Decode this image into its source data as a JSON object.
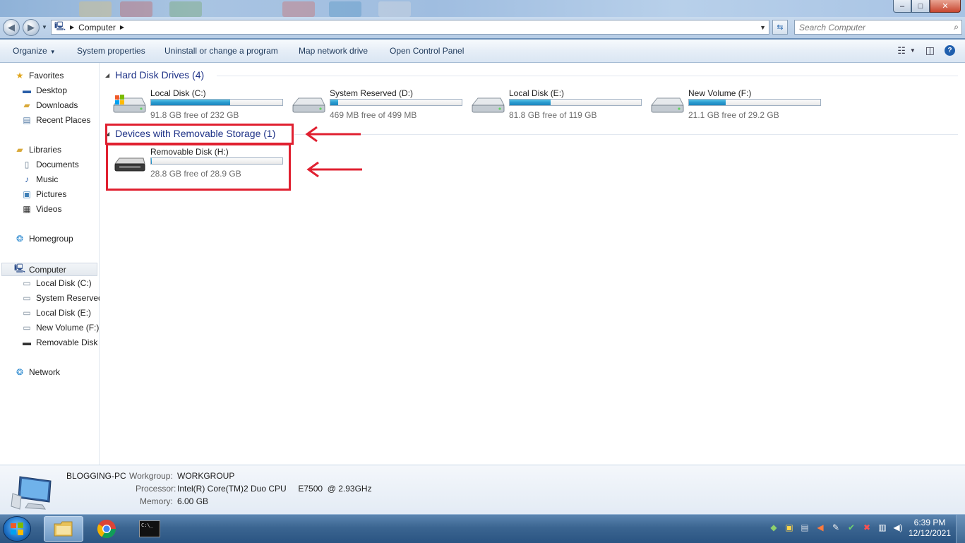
{
  "window": {
    "minimize_glyph": "–",
    "maximize_glyph": "□",
    "close_glyph": "✕"
  },
  "address": {
    "location": "Computer",
    "search_placeholder": "Search Computer"
  },
  "toolbar": {
    "organize": "Organize",
    "system_properties": "System properties",
    "uninstall": "Uninstall or change a program",
    "map_network_drive": "Map network drive",
    "open_control_panel": "Open Control Panel",
    "help_glyph": "?"
  },
  "nav": {
    "favorites": "Favorites",
    "desktop": "Desktop",
    "downloads": "Downloads",
    "recent_places": "Recent Places",
    "libraries": "Libraries",
    "documents": "Documents",
    "music": "Music",
    "pictures": "Pictures",
    "videos": "Videos",
    "homegroup": "Homegroup",
    "computer": "Computer",
    "local_c": "Local Disk (C:)",
    "system_reserved": "System Reserved",
    "local_e": "Local Disk (E:)",
    "new_volume": "New Volume (F:)",
    "removable": "Removable Disk",
    "network": "Network"
  },
  "groups": {
    "hdd_title": "Hard Disk Drives (4)",
    "removable_title": "Devices with Removable Storage (1)"
  },
  "drives": [
    {
      "name": "Local Disk (C:)",
      "free": "91.8 GB free of 232 GB",
      "used_fraction": 0.604
    },
    {
      "name": "System Reserved (D:)",
      "free": "469 MB free of 499 MB",
      "used_fraction": 0.06
    },
    {
      "name": "Local Disk (E:)",
      "free": "81.8 GB free of 119 GB",
      "used_fraction": 0.313
    },
    {
      "name": "New Volume (F:)",
      "free": "21.1 GB free of 29.2 GB",
      "used_fraction": 0.277
    }
  ],
  "removable_drive": {
    "name": "Removable Disk (H:)",
    "free": "28.8 GB free of 28.9 GB",
    "used_fraction": 0.003
  },
  "details": {
    "pc_name": "BLOGGING-PC",
    "workgroup_label": "Workgroup:",
    "workgroup": "WORKGROUP",
    "processor_label": "Processor:",
    "processor": "Intel(R) Core(TM)2 Duo CPU     E7500  @ 2.93GHz",
    "memory_label": "Memory:",
    "memory": "6.00 GB"
  },
  "taskbar": {
    "time": "6:39 PM",
    "date": "12/12/2021",
    "cmd_label": "C:\\_"
  },
  "colors": {
    "annotation": "#e02030",
    "bar_fill": "#2a9bd0"
  }
}
